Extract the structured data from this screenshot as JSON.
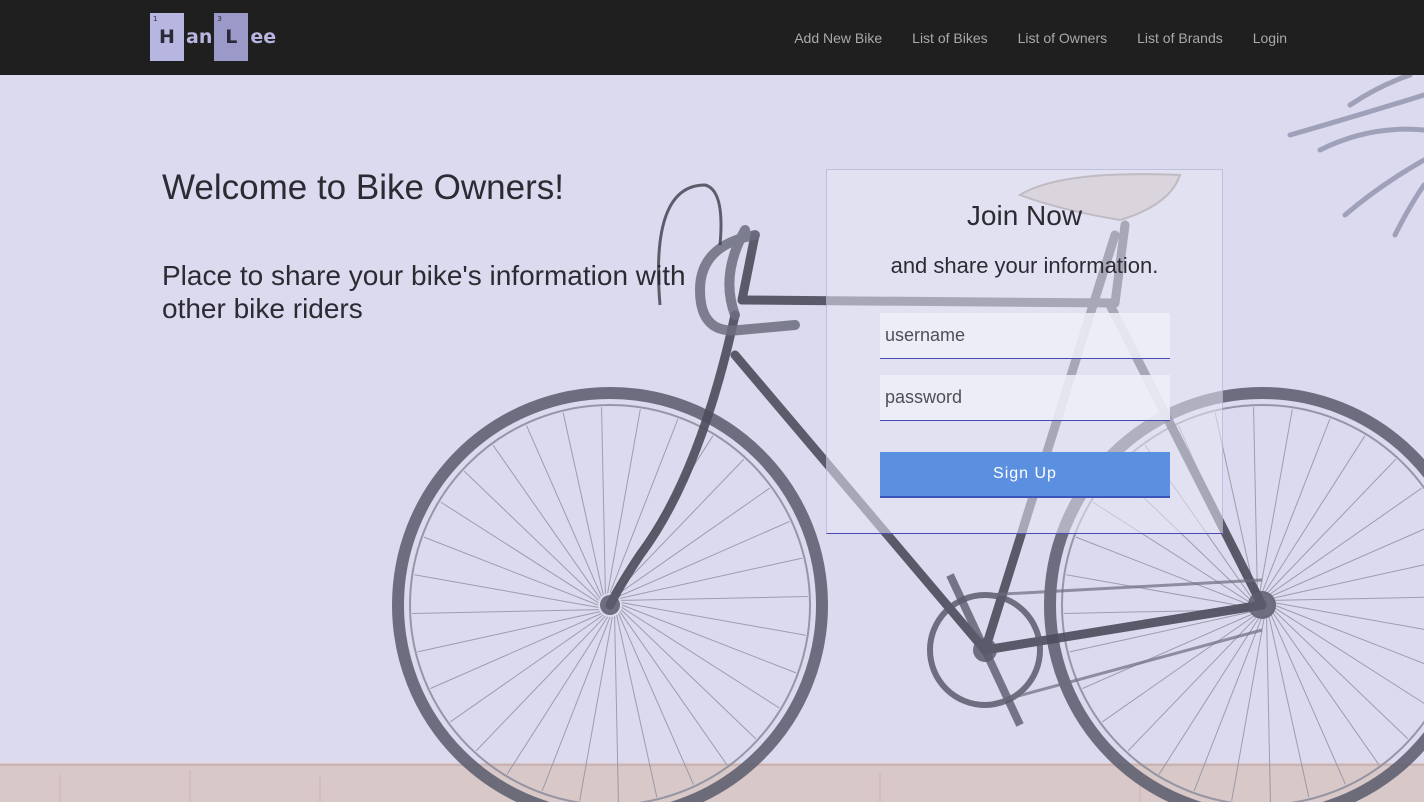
{
  "logo": {
    "tile1_letter": "H",
    "tile1_number": "1",
    "part1": "an",
    "tile2_letter": "L",
    "tile2_number": "3",
    "part2": "ee"
  },
  "nav": {
    "items": [
      {
        "label": "Add New Bike"
      },
      {
        "label": "List of Bikes"
      },
      {
        "label": "List of Owners"
      },
      {
        "label": "List of Brands"
      },
      {
        "label": "Login"
      }
    ]
  },
  "hero": {
    "welcome": "Welcome to Bike Owners!",
    "tagline": "Place to share your bike's information with other bike riders"
  },
  "signup": {
    "title": "Join Now",
    "subtitle": "and share your information.",
    "username_placeholder": "username",
    "password_placeholder": "password",
    "button_label": "Sign Up"
  },
  "colors": {
    "navbar": "#1f1f1f",
    "overlay": "#dcdcef",
    "accent": "#5b8fdf",
    "underline": "#4a49b8"
  }
}
